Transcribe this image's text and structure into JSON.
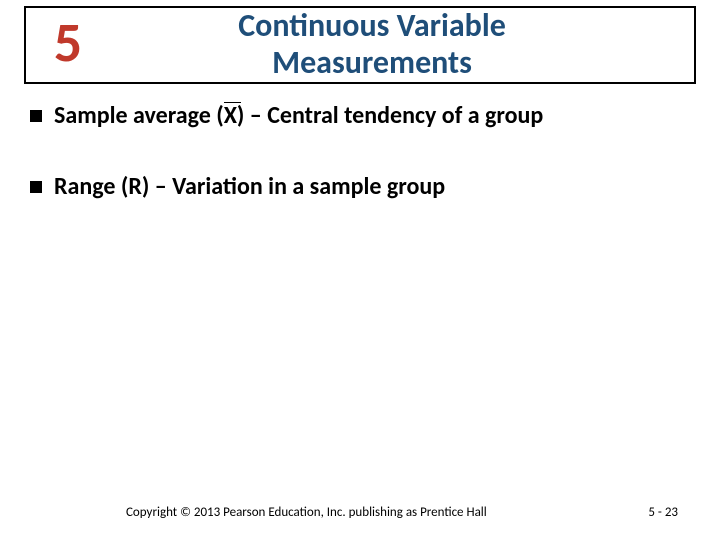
{
  "header": {
    "chapter": "5",
    "title_line1": "Continuous Variable",
    "title_line2": "Measurements"
  },
  "bullets": {
    "b1_prefix": "Sample average (",
    "b1_xbar": "X",
    "b1_after_paren": ") – Central tendency of a group",
    "b2_bold": "Range (R)",
    "b2_rest": " – Variation in a sample group"
  },
  "footer": {
    "copyright": "Copyright © 2013 Pearson Education, Inc. publishing as Prentice Hall",
    "page": "5 - 23"
  }
}
